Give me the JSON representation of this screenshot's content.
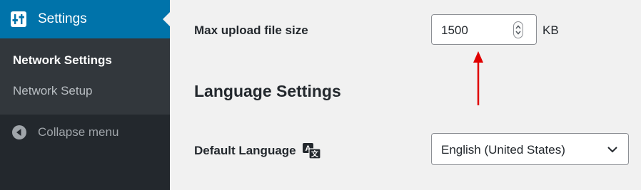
{
  "sidebar": {
    "active_menu": {
      "label": "Settings",
      "icon": "settings-sliders-icon"
    },
    "submenu": [
      {
        "label": "Network Settings",
        "current": true
      },
      {
        "label": "Network Setup",
        "current": false
      }
    ],
    "collapse": {
      "label": "Collapse menu",
      "icon": "collapse-arrow-icon"
    }
  },
  "settings": {
    "max_upload": {
      "label": "Max upload file size",
      "value": "1500",
      "unit": "KB"
    },
    "language_section": {
      "heading": "Language Settings"
    },
    "default_language": {
      "label": "Default Language",
      "icon": "translation-icon",
      "selected": "English (United States)"
    }
  },
  "annotation": {
    "arrow_color": "#e00000"
  },
  "colors": {
    "sidebar_bg": "#23282d",
    "submenu_bg": "#32373c",
    "accent": "#0073aa",
    "content_bg": "#f1f1f1"
  }
}
